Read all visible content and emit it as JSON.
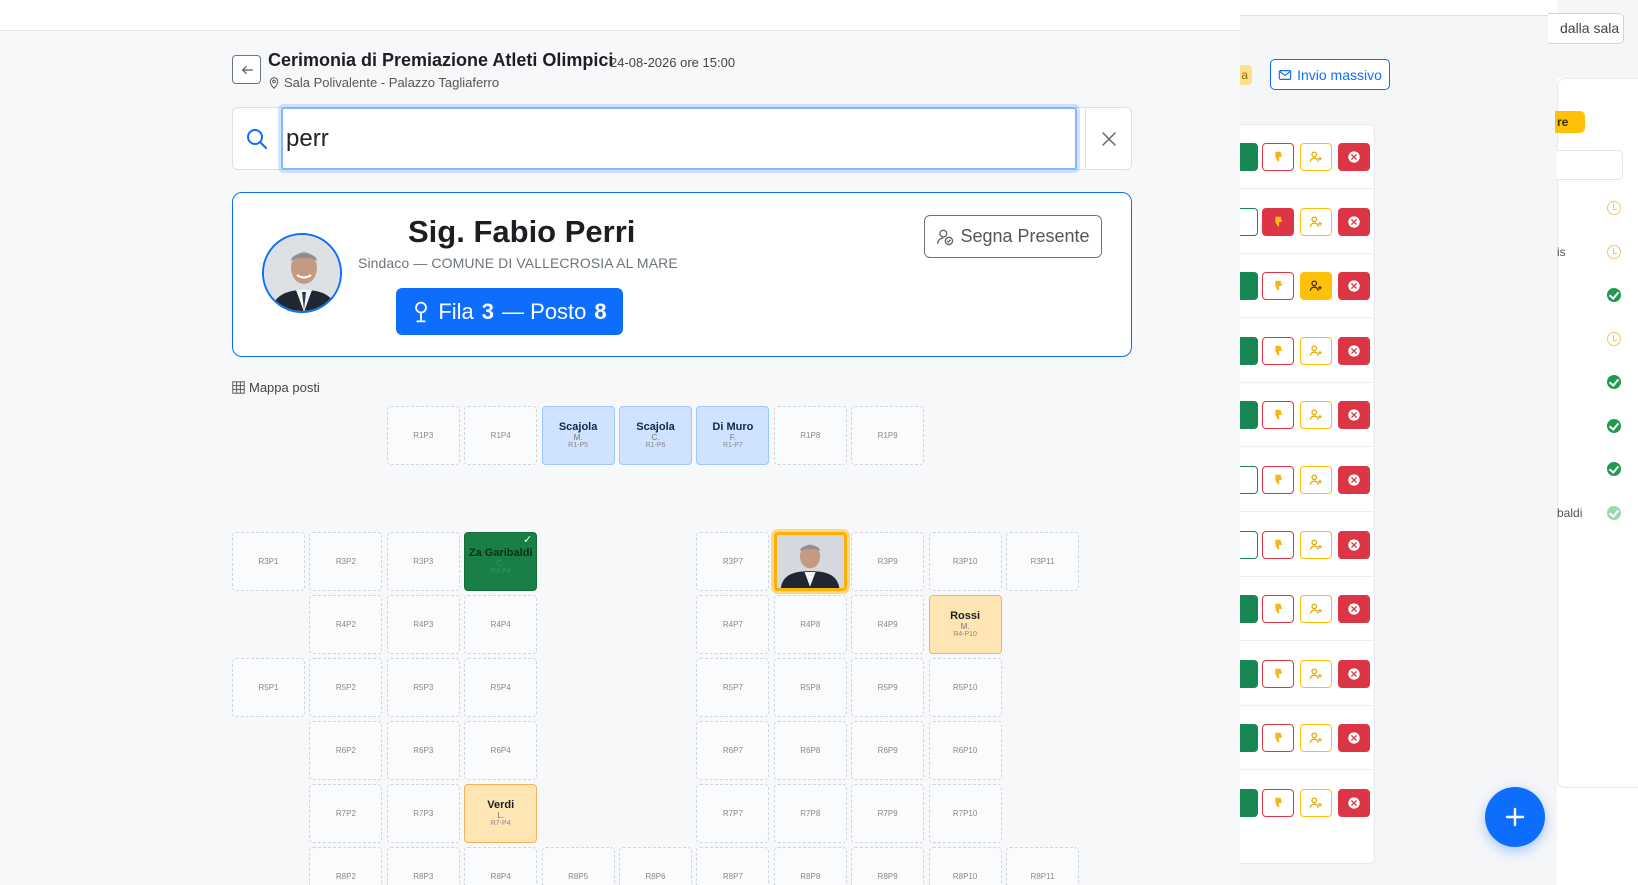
{
  "background": {
    "remove_button_partial": "dalla sala",
    "partial_badge": "a",
    "bulk_send_label": "Invio massivo",
    "side_badge_partial": "re",
    "side_rows": [
      {
        "text": "",
        "status": "clock"
      },
      {
        "text": "is",
        "status": "clock"
      },
      {
        "text": "",
        "status": "ok"
      },
      {
        "text": "",
        "status": "clock"
      },
      {
        "text": "",
        "status": "ok"
      },
      {
        "text": "",
        "status": "ok"
      },
      {
        "text": "",
        "status": "ok"
      },
      {
        "text": "baldi",
        "status": "ok-faded"
      }
    ],
    "action_rows": [
      {
        "green": "solid",
        "dislike": "outline",
        "person": "outline"
      },
      {
        "green": "outline",
        "dislike": "solid",
        "person": "outline"
      },
      {
        "green": "solid",
        "dislike": "outline",
        "person": "solid"
      },
      {
        "green": "solid",
        "dislike": "outline",
        "person": "outline"
      },
      {
        "green": "solid",
        "dislike": "outline",
        "person": "outline"
      },
      {
        "green": "outline",
        "dislike": "outline",
        "person": "outline"
      },
      {
        "green": "outline",
        "dislike": "outline",
        "person": "outline"
      },
      {
        "green": "solid",
        "dislike": "outline",
        "person": "outline"
      },
      {
        "green": "solid",
        "dislike": "outline",
        "person": "outline"
      },
      {
        "green": "solid",
        "dislike": "outline",
        "person": "outline"
      },
      {
        "green": "solid",
        "dislike": "outline",
        "person": "outline"
      }
    ]
  },
  "event": {
    "title": "Cerimonia di Premiazione Atleti Olimpici",
    "date": "24-08-2026 ore 15:00",
    "location": "Sala Polivalente - Palazzo Tagliaferro"
  },
  "search": {
    "value": "perr",
    "placeholder": ""
  },
  "result": {
    "name": "Sig. Fabio Perri",
    "role": "Sindaco — COMUNE DI VALLECROSIA AL MARE",
    "row_label": "Fila",
    "row": "3",
    "separator": "— Posto",
    "seat": "8",
    "present_label": "Segna Presente"
  },
  "map": {
    "label": "Mappa posti",
    "seats": [
      {
        "id": "R1P3",
        "state": "empty",
        "col": 2,
        "rowpos": 0
      },
      {
        "id": "R1P4",
        "state": "empty",
        "col": 3,
        "rowpos": 0
      },
      {
        "id": "R1-P5",
        "state": "blue",
        "col": 4,
        "rowpos": 0,
        "name": "Scajola",
        "initial": "M."
      },
      {
        "id": "R1-P6",
        "state": "blue",
        "col": 5,
        "rowpos": 0,
        "name": "Scajola",
        "initial": "C."
      },
      {
        "id": "R1-P7",
        "state": "blue",
        "col": 6,
        "rowpos": 0,
        "name": "Di Muro",
        "initial": "F."
      },
      {
        "id": "R1P8",
        "state": "empty",
        "col": 7,
        "rowpos": 0
      },
      {
        "id": "R1P9",
        "state": "empty",
        "col": 8,
        "rowpos": 0
      },
      {
        "id": "R3P1",
        "state": "empty",
        "col": 0,
        "rowpos": 2
      },
      {
        "id": "R3P2",
        "state": "empty",
        "col": 1,
        "rowpos": 2
      },
      {
        "id": "R3P3",
        "state": "empty",
        "col": 2,
        "rowpos": 2
      },
      {
        "id": "R3-P4",
        "state": "green",
        "col": 3,
        "rowpos": 2,
        "name": "Za Garibaldi",
        "initial": "C.",
        "check": "✓"
      },
      {
        "id": "R3P7",
        "state": "empty",
        "col": 6,
        "rowpos": 2
      },
      {
        "id": "R3P8",
        "state": "highlight",
        "col": 7,
        "rowpos": 2
      },
      {
        "id": "R3P9",
        "state": "empty",
        "col": 8,
        "rowpos": 2
      },
      {
        "id": "R3P10",
        "state": "empty",
        "col": 9,
        "rowpos": 2
      },
      {
        "id": "R3P11",
        "state": "empty",
        "col": 10,
        "rowpos": 2
      },
      {
        "id": "R4P2",
        "state": "empty",
        "col": 1,
        "rowpos": 3
      },
      {
        "id": "R4P3",
        "state": "empty",
        "col": 2,
        "rowpos": 3
      },
      {
        "id": "R4P4",
        "state": "empty",
        "col": 3,
        "rowpos": 3
      },
      {
        "id": "R4P7",
        "state": "empty",
        "col": 6,
        "rowpos": 3
      },
      {
        "id": "R4P8",
        "state": "empty",
        "col": 7,
        "rowpos": 3
      },
      {
        "id": "R4P9",
        "state": "empty",
        "col": 8,
        "rowpos": 3
      },
      {
        "id": "R4-P10",
        "state": "orange",
        "col": 9,
        "rowpos": 3,
        "name": "Rossi",
        "initial": "M."
      },
      {
        "id": "R5P1",
        "state": "empty",
        "col": 0,
        "rowpos": 4
      },
      {
        "id": "R5P2",
        "state": "empty",
        "col": 1,
        "rowpos": 4
      },
      {
        "id": "R5P3",
        "state": "empty",
        "col": 2,
        "rowpos": 4
      },
      {
        "id": "R5P4",
        "state": "empty",
        "col": 3,
        "rowpos": 4
      },
      {
        "id": "R5P7",
        "state": "empty",
        "col": 6,
        "rowpos": 4
      },
      {
        "id": "R5P8",
        "state": "empty",
        "col": 7,
        "rowpos": 4
      },
      {
        "id": "R5P9",
        "state": "empty",
        "col": 8,
        "rowpos": 4
      },
      {
        "id": "R5P10",
        "state": "empty",
        "col": 9,
        "rowpos": 4
      },
      {
        "id": "R6P2",
        "state": "empty",
        "col": 1,
        "rowpos": 5
      },
      {
        "id": "R6P3",
        "state": "empty",
        "col": 2,
        "rowpos": 5
      },
      {
        "id": "R6P4",
        "state": "empty",
        "col": 3,
        "rowpos": 5
      },
      {
        "id": "R6P7",
        "state": "empty",
        "col": 6,
        "rowpos": 5
      },
      {
        "id": "R6P8",
        "state": "empty",
        "col": 7,
        "rowpos": 5
      },
      {
        "id": "R6P9",
        "state": "empty",
        "col": 8,
        "rowpos": 5
      },
      {
        "id": "R6P10",
        "state": "empty",
        "col": 9,
        "rowpos": 5
      },
      {
        "id": "R7P2",
        "state": "empty",
        "col": 1,
        "rowpos": 6
      },
      {
        "id": "R7P3",
        "state": "empty",
        "col": 2,
        "rowpos": 6
      },
      {
        "id": "R7-P4",
        "state": "orange",
        "col": 3,
        "rowpos": 6,
        "name": "Verdi",
        "initial": "L."
      },
      {
        "id": "R7P7",
        "state": "empty",
        "col": 6,
        "rowpos": 6
      },
      {
        "id": "R7P8",
        "state": "empty",
        "col": 7,
        "rowpos": 6
      },
      {
        "id": "R7P9",
        "state": "empty",
        "col": 8,
        "rowpos": 6
      },
      {
        "id": "R7P10",
        "state": "empty",
        "col": 9,
        "rowpos": 6
      },
      {
        "id": "R8P2",
        "state": "empty",
        "col": 1,
        "rowpos": 7
      },
      {
        "id": "R8P3",
        "state": "empty",
        "col": 2,
        "rowpos": 7
      },
      {
        "id": "R8P4",
        "state": "empty",
        "col": 3,
        "rowpos": 7
      },
      {
        "id": "R8P5",
        "state": "empty",
        "col": 4,
        "rowpos": 7
      },
      {
        "id": "R8P6",
        "state": "empty",
        "col": 5,
        "rowpos": 7
      },
      {
        "id": "R8P7",
        "state": "empty",
        "col": 6,
        "rowpos": 7
      },
      {
        "id": "R8P8",
        "state": "empty",
        "col": 7,
        "rowpos": 7
      },
      {
        "id": "R8P9",
        "state": "empty",
        "col": 8,
        "rowpos": 7
      },
      {
        "id": "R8P10",
        "state": "empty",
        "col": 9,
        "rowpos": 7
      },
      {
        "id": "R8P11",
        "state": "empty",
        "col": 10,
        "rowpos": 7
      }
    ]
  },
  "colors": {
    "primary": "#0d6efd",
    "success": "#198754",
    "danger": "#dc3545",
    "warning": "#ffc107"
  }
}
